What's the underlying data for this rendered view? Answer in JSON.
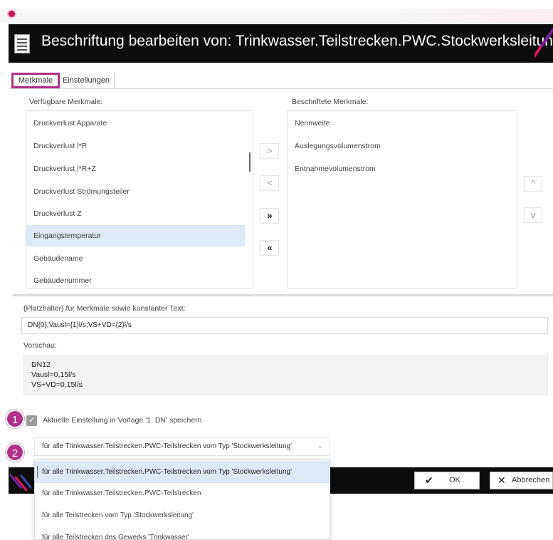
{
  "window": {
    "title": "Beschriftung bearbeiten von: Trinkwasser.Teilstrecken.PWC.Stockwerksleitung"
  },
  "tabs": [
    {
      "label": "Merkmale",
      "active": true
    },
    {
      "label": "Einstellungen",
      "active": false
    }
  ],
  "available": {
    "label": "Verfügbare Merkmale:",
    "items": [
      "Druckverlust Apparate",
      "Druckverlust l*R",
      "Druckverlust l*R+Z",
      "Druckverlust Strömungsteiler",
      "Druckverlust Z",
      "Eingangstemperatur",
      "Gebäudename",
      "Gebäudenummer"
    ],
    "selected_index": 5
  },
  "transfer_buttons": {
    "add": ">",
    "remove": "<",
    "add_all": "»",
    "remove_all": "«"
  },
  "labeled": {
    "label": "Beschriftete Merkmale:",
    "items": [
      "Nennweite",
      "Auslegungsvolumenstrom",
      "Entnahmevolumenstrom"
    ]
  },
  "order_buttons": {
    "up": "^",
    "down": "v"
  },
  "placeholder": {
    "label": "{Platzhalter} für Merkmale sowie konstanter Text:",
    "value": "DN{0};Vausl={1}l/s;VS+VD={2}l/s"
  },
  "preview": {
    "label": "Vorschau:",
    "lines": [
      "DN12",
      "Vausl=0,15l/s",
      "VS+VD=0,15l/s"
    ]
  },
  "save_option": {
    "badge": "1",
    "checked": true,
    "label": "Aktuelle Einstellung in Vorlage '1. DN' speichern"
  },
  "scope": {
    "badge": "2",
    "selected": "für alle Trinkwasser.Teilstrecken.PWC-Teilstrecken vom Typ 'Stockwerksleitung'",
    "options": [
      "für alle Trinkwasser.Teilstrecken.PWC-Teilstrecken vom Typ 'Stockwerksleitung'",
      "für alle Trinkwasser.Teilstrecken.PWC-Teilstrecken",
      "für alle Teilstrecken vom Typ 'Stockwerksleitung'",
      "für alle Teilstrecken des Gewerks 'Trinkwasser'"
    ]
  },
  "footer": {
    "ok_label": "OK",
    "cancel_label": "Abbrechen"
  },
  "colors": {
    "accent": "#b0308a",
    "titlebar": "#0d0d0d",
    "selection": "#dce9f6"
  },
  "icons": {
    "app": "app-icon",
    "document": "document-icon",
    "check": "checkmark-icon",
    "cancel": "x-icon",
    "chevron": "chevron-down-icon"
  }
}
